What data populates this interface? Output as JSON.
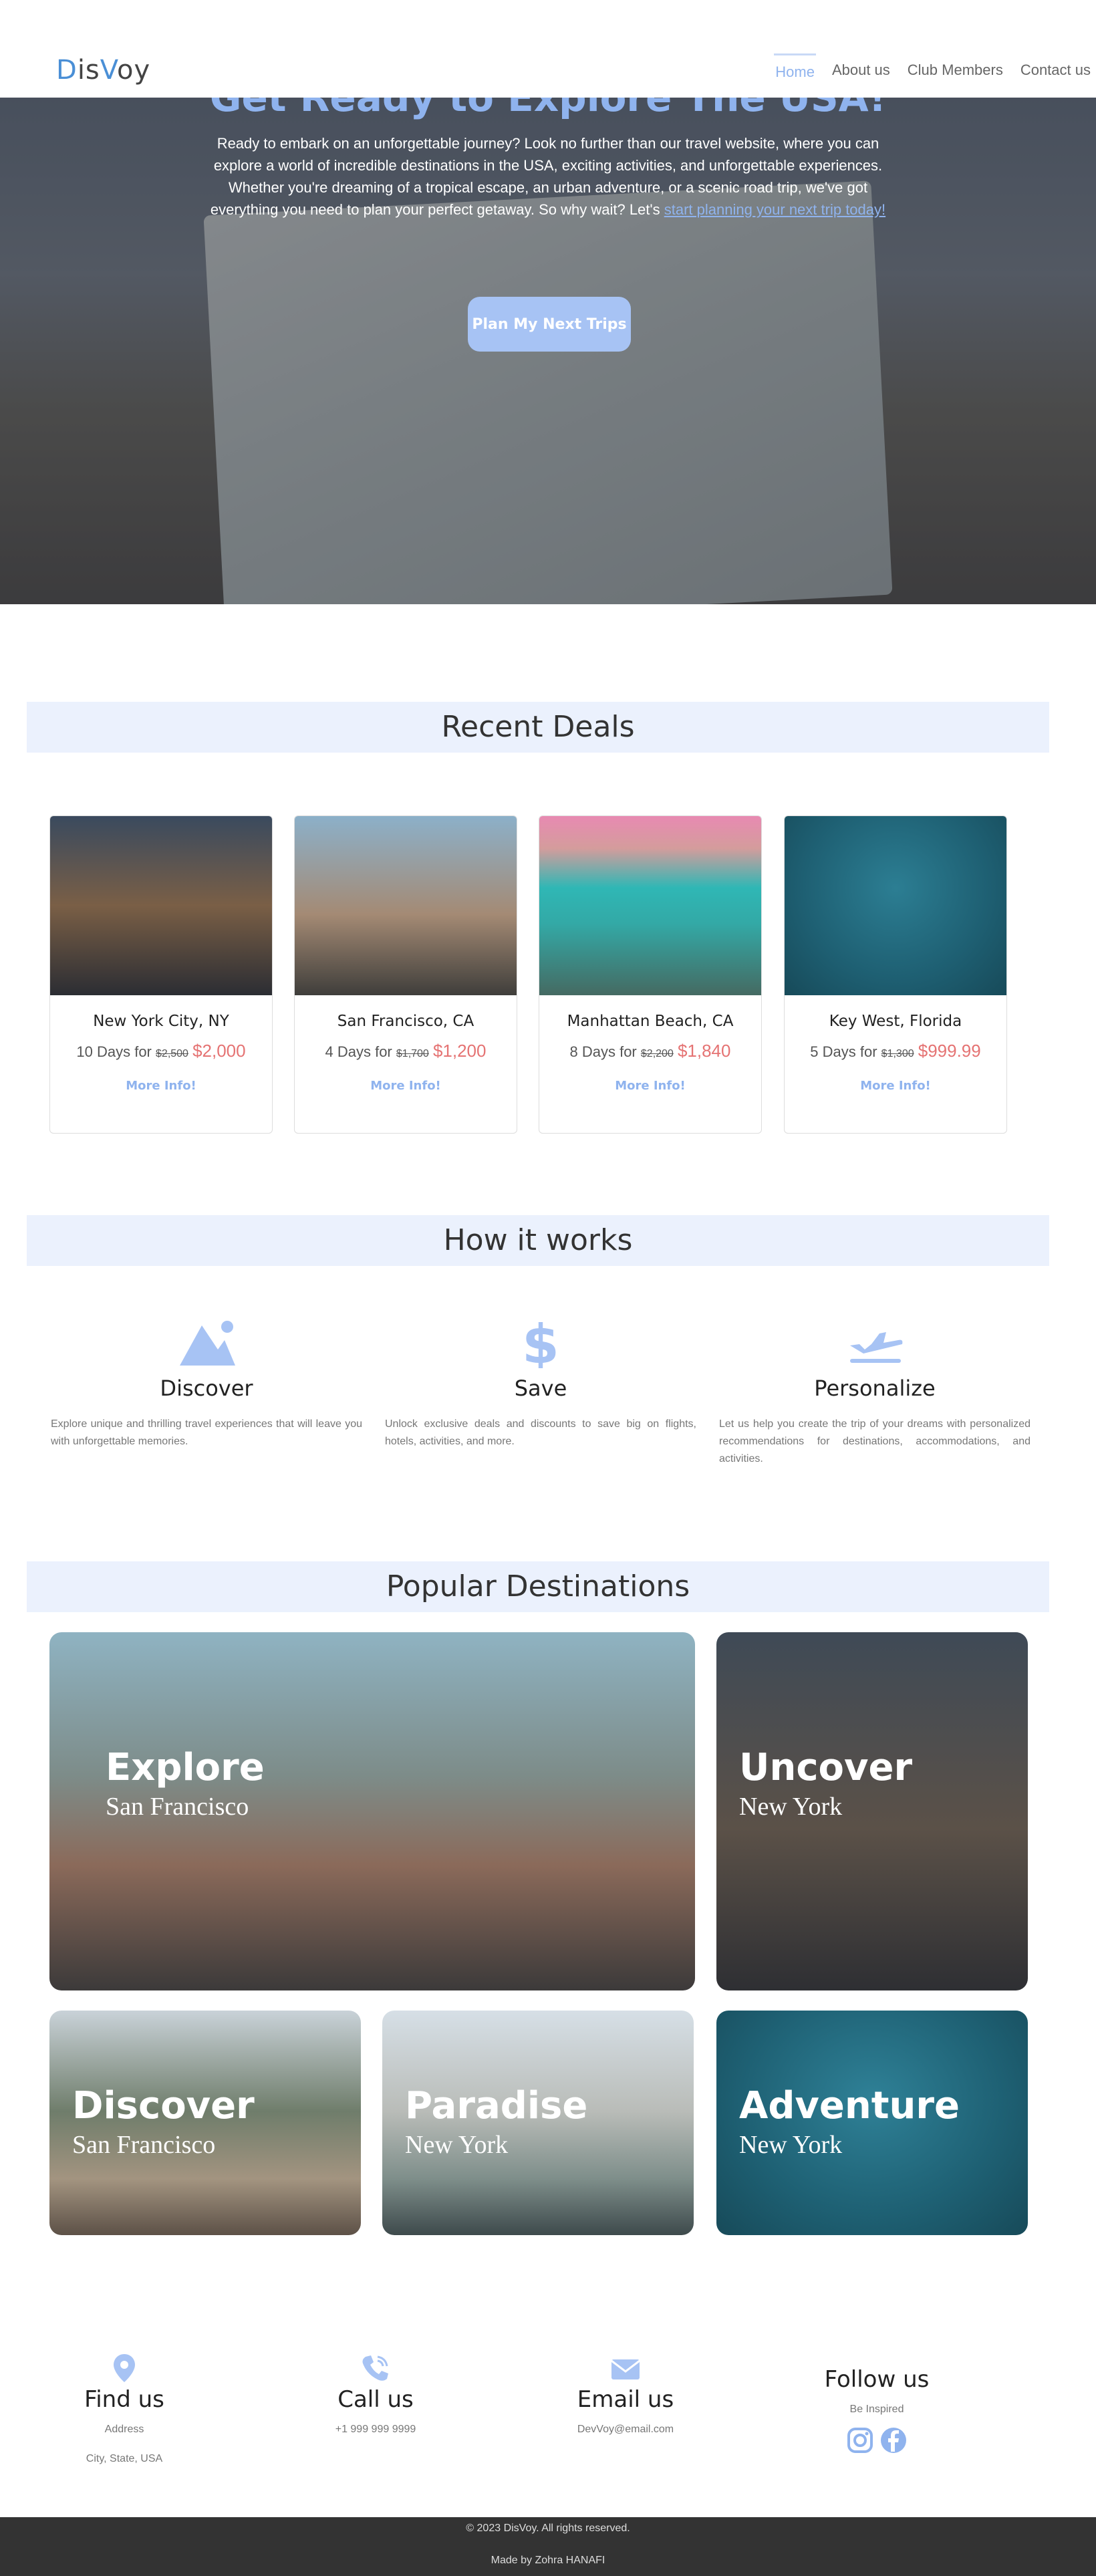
{
  "nav": {
    "logo_parts": [
      "D",
      "is",
      "V",
      "oy"
    ],
    "items": [
      {
        "label": "Home",
        "active": true
      },
      {
        "label": "About us"
      },
      {
        "label": "Club Members"
      },
      {
        "label": "Contact us"
      }
    ]
  },
  "hero": {
    "title": "Get Ready to Explore The USA!",
    "text": "Ready to embark on an unforgettable journey? Look no further than our travel website, where you can explore a world of incredible destinations in the USA, exciting activities, and unforgettable experiences. Whether you're dreaming of a tropical escape, an urban adventure, or a scenic road trip, we've got everything you need to plan your perfect getaway. So why wait? Let's ",
    "link": "start planning your next trip today!",
    "button": "Plan My Next Trips"
  },
  "deals": {
    "heading": "Recent Deals",
    "items": [
      {
        "title": "New York City, NY",
        "days": "10 Days for",
        "old": "$2,500",
        "new": "$2,000",
        "more": "More Info!"
      },
      {
        "title": "San Francisco, CA",
        "days": "4 Days for",
        "old": "$1,700",
        "new": "$1,200",
        "more": "More Info!"
      },
      {
        "title": "Manhattan Beach, CA",
        "days": "8 Days for",
        "old": "$2,200",
        "new": "$1,840",
        "more": "More Info!"
      },
      {
        "title": "Key West, Florida",
        "days": "5 Days for",
        "old": "$1,300",
        "new": "$999.99",
        "more": "More Info!"
      }
    ]
  },
  "how": {
    "heading": "How it works",
    "items": [
      {
        "title": "Discover",
        "text": "Explore unique and thrilling travel experiences that will leave you with unforgettable memories."
      },
      {
        "title": "Save",
        "text": "Unlock exclusive deals and discounts to save big on flights, hotels, activities, and more."
      },
      {
        "title": "Personalize",
        "text": "Let us help you create the trip of your dreams with personalized recommendations for destinations, accommodations, and activities."
      }
    ]
  },
  "destinations": {
    "heading": "Popular Destinations",
    "items": [
      {
        "big": "Explore",
        "small": "San Francisco"
      },
      {
        "big": "Uncover",
        "small": "New York"
      },
      {
        "big": "Discover",
        "small": "San Francisco"
      },
      {
        "big": "Paradise",
        "small": "New York"
      },
      {
        "big": "Adventure",
        "small": "New York"
      }
    ]
  },
  "footer": {
    "find": {
      "title": "Find us",
      "line1": "Address",
      "line2": "City, State, USA"
    },
    "call": {
      "title": "Call us",
      "line1": "+1 999 999 9999"
    },
    "email": {
      "title": "Email us",
      "line1": "DevVoy@email.com"
    },
    "follow": {
      "title": "Follow us",
      "line1": "Be Inspired"
    },
    "copyright": "© 2023 DisVoy. All rights reserved.",
    "credit": "Made by Zohra HANAFI"
  },
  "colors": {
    "accent": "#8fb3ee",
    "band": "#ebf1fd",
    "price": "#e57373",
    "footer": "#333333"
  }
}
